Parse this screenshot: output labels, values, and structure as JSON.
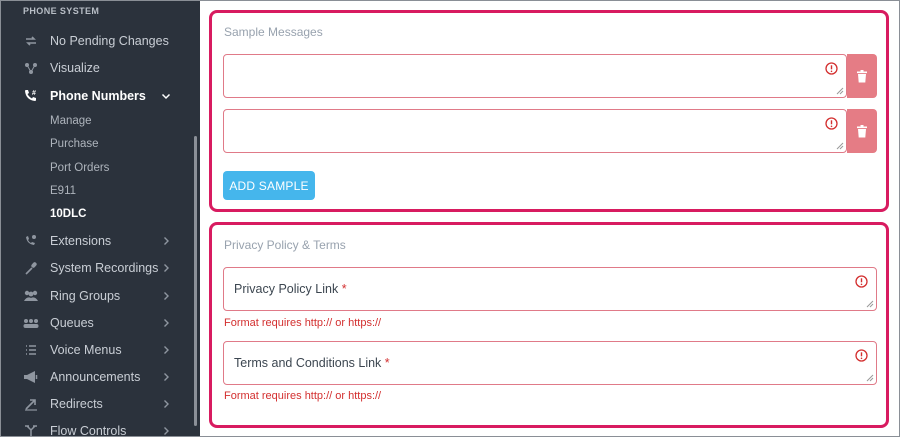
{
  "sidebar": {
    "section_title": "PHONE SYSTEM",
    "items": [
      {
        "label": "No Pending Changes",
        "icon": "sync-icon"
      },
      {
        "label": "Visualize",
        "icon": "hierarchy-icon"
      },
      {
        "label": "Phone Numbers",
        "icon": "phone-hash-icon",
        "expanded": true
      },
      {
        "label": "Extensions",
        "icon": "phone-extension-icon"
      },
      {
        "label": "System Recordings",
        "icon": "microphone-icon"
      },
      {
        "label": "Ring Groups",
        "icon": "ring-groups-icon"
      },
      {
        "label": "Queues",
        "icon": "queues-icon"
      },
      {
        "label": "Voice Menus",
        "icon": "voice-menu-icon"
      },
      {
        "label": "Announcements",
        "icon": "megaphone-icon"
      },
      {
        "label": "Redirects",
        "icon": "redirect-icon"
      },
      {
        "label": "Flow Controls",
        "icon": "flow-control-icon"
      }
    ],
    "sub_items": [
      "Manage",
      "Purchase",
      "Port Orders",
      "E911",
      "10DLC"
    ],
    "active_sub": "10DLC"
  },
  "sample_messages": {
    "title": "Sample Messages",
    "add_label": "ADD SAMPLE"
  },
  "privacy": {
    "title": "Privacy Policy & Terms",
    "privacy_label": "Privacy Policy Link",
    "terms_label": "Terms and Conditions Link",
    "required_mark": "*",
    "privacy_error": "Format requires http:// or https://",
    "terms_error": "Format requires http:// or https://"
  },
  "colors": {
    "sidebar_bg": "#2b323c",
    "highlight_border": "#d81b60",
    "error_red": "#d32f2f",
    "add_button": "#45b6ec",
    "delete_button": "#e57c85"
  }
}
